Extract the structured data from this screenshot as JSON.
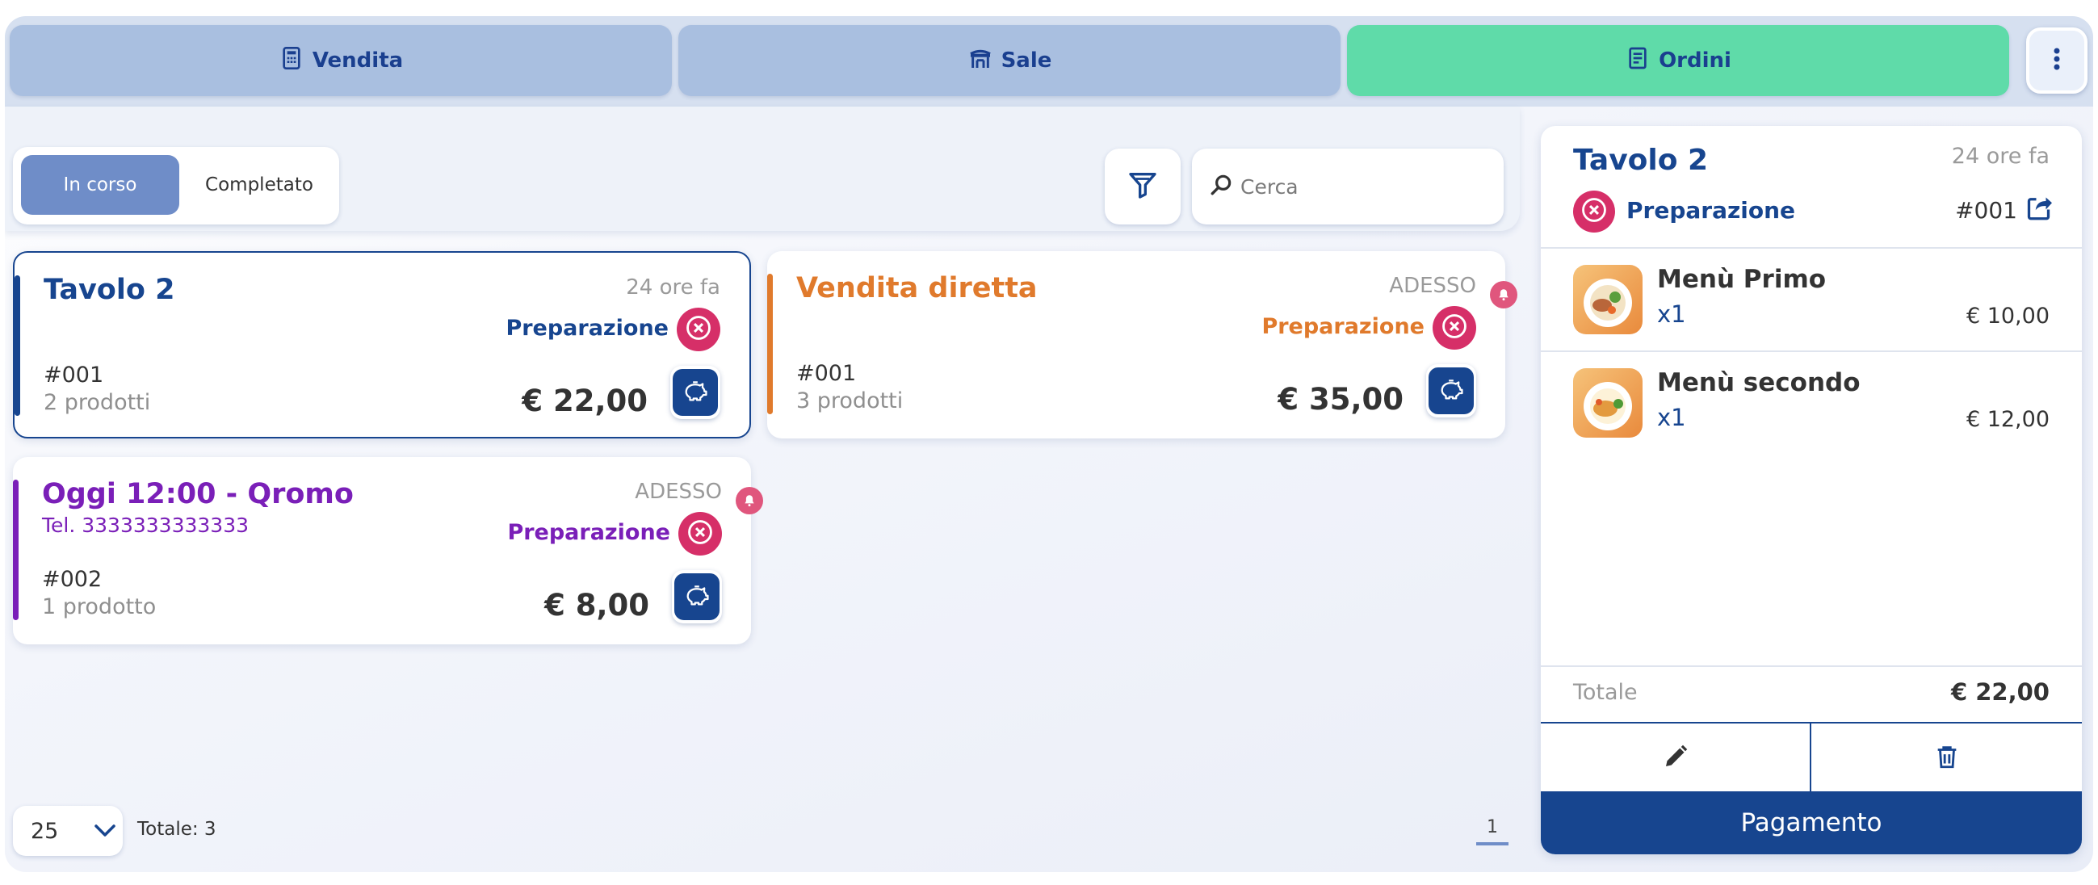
{
  "colors": {
    "primary": "#17458f",
    "tab_inactive": "#a9bfe0",
    "tab_active": "#5fdba9",
    "orange": "#e07a2c",
    "purple": "#7a1fb8",
    "cancel_red": "#d62f68"
  },
  "tabs": [
    {
      "label": "Vendita",
      "icon": "cash-register-icon"
    },
    {
      "label": "Sale",
      "icon": "table-chairs-icon"
    },
    {
      "label": "Ordini",
      "icon": "receipt-icon",
      "active": true
    }
  ],
  "filters": {
    "segments": [
      "In corso",
      "Completato"
    ],
    "active_segment": "In corso",
    "search_placeholder": "Cerca"
  },
  "orders": [
    {
      "title": "Tavolo 2",
      "time": "24 ore fa",
      "status": "Preparazione",
      "number": "#001",
      "products": "2 prodotti",
      "price": "€ 22,00",
      "accent": "#17458f",
      "selected": true
    },
    {
      "title": "Vendita diretta",
      "time": "ADESSO",
      "status": "Preparazione",
      "number": "#001",
      "products": "3 prodotti",
      "price": "€ 35,00",
      "accent": "#e07a2c",
      "bell": true
    },
    {
      "title": "Oggi 12:00 - Qromo",
      "phone": "Tel. 3333333333333",
      "time": "ADESSO",
      "status": "Preparazione",
      "number": "#002",
      "products": "1 prodotto",
      "price": "€ 8,00",
      "accent": "#7a1fb8",
      "bell": true
    }
  ],
  "pager": {
    "page_size": "25",
    "total": "Totale: 3",
    "page": "1"
  },
  "detail": {
    "title": "Tavolo 2",
    "time": "24 ore fa",
    "status": "Preparazione",
    "number": "#001",
    "items": [
      {
        "name": "Menù Primo",
        "qty": "x1",
        "price": "€ 10,00"
      },
      {
        "name": "Menù secondo",
        "qty": "x1",
        "price": "€ 12,00"
      }
    ],
    "total_label": "Totale",
    "total": "€ 22,00",
    "pay_label": "Pagamento"
  }
}
